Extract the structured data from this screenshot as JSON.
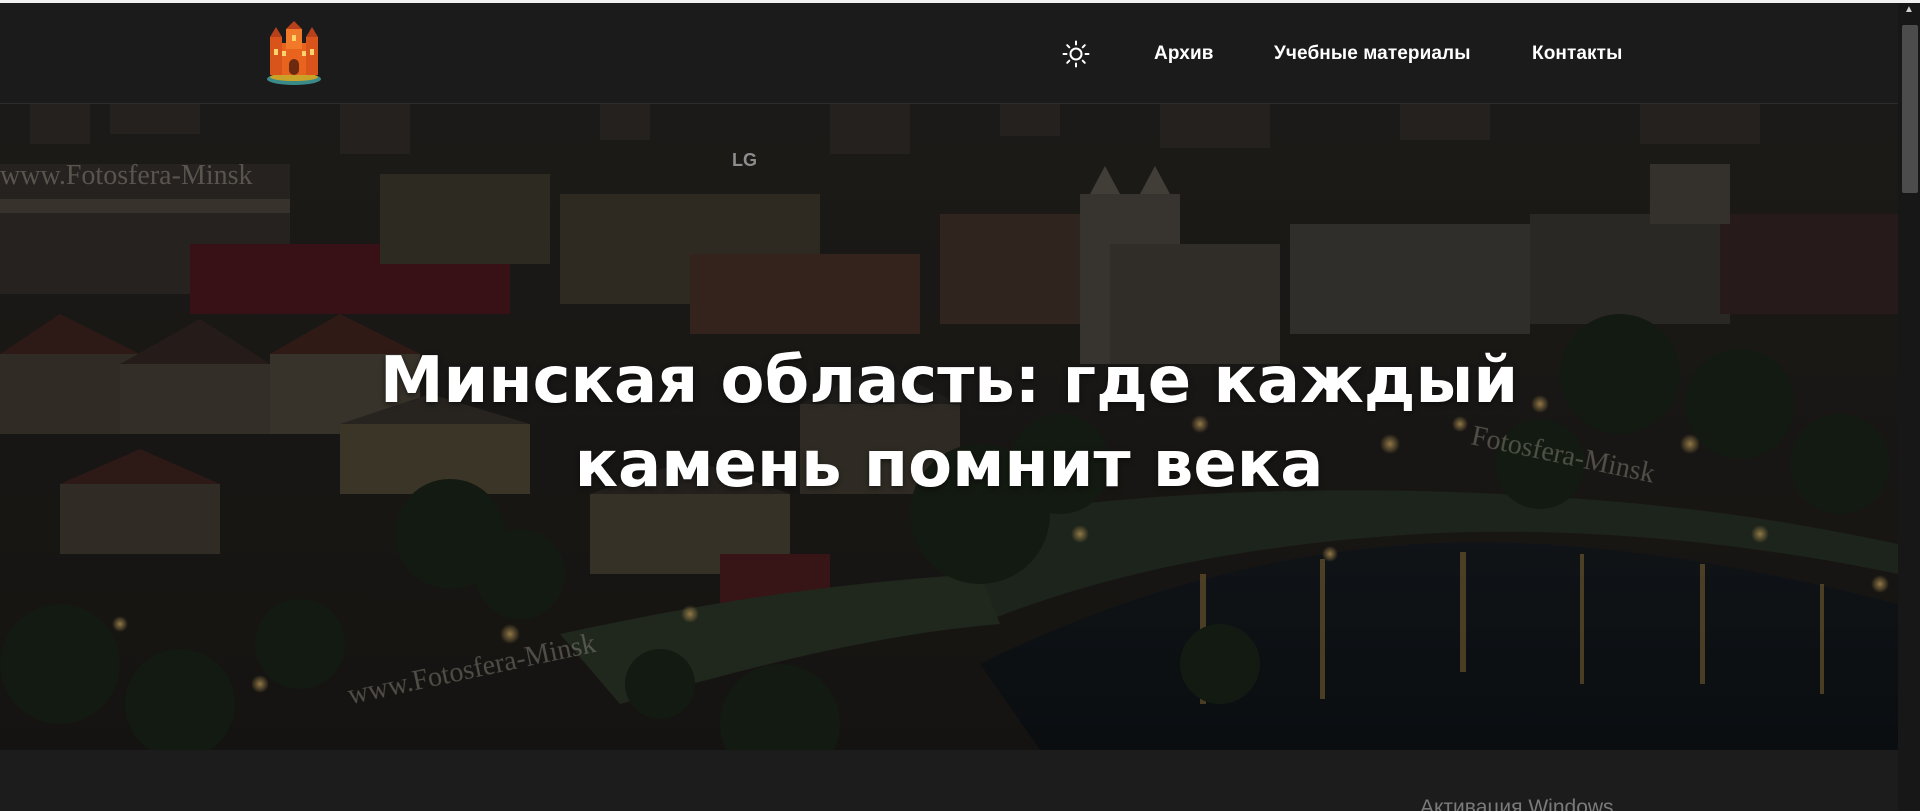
{
  "header": {
    "logo_icon": "castle-logo-icon",
    "theme_toggle_icon": "sun-icon",
    "nav": {
      "archive": "Архив",
      "materials": "Учебные материалы",
      "contacts": "Контакты"
    }
  },
  "hero": {
    "title_line1": "Минская область: где каждый",
    "title_line2": "камень помнит века",
    "photo_watermarks": [
      "www.Fotosfera-Minsk",
      "www.Fotosfera-Minsk",
      "Fotosfera-Minsk"
    ],
    "photo_sign": "LG"
  },
  "os_overlay": {
    "text": "Активация Windows"
  },
  "colors": {
    "header_bg": "#1b1b1b",
    "page_bg": "#1c1c1c",
    "text": "#ffffff",
    "accent_logo": "#e8641e"
  }
}
